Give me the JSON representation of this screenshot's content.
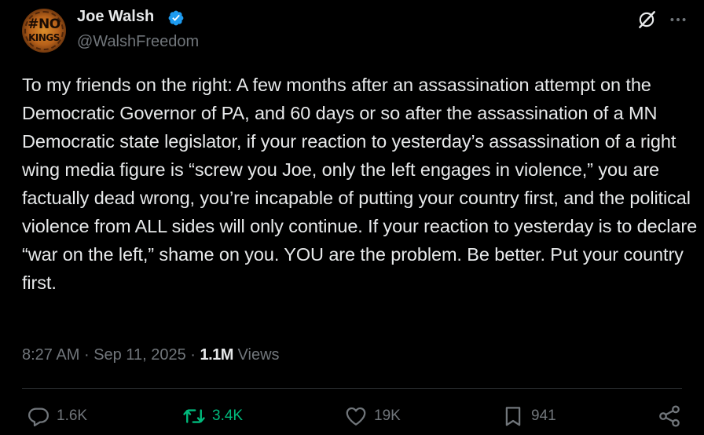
{
  "author": {
    "avatar_line1": "#NO",
    "avatar_line2": "KINGS",
    "name": "Joe Walsh",
    "handle": "@WalshFreedom",
    "verified": true
  },
  "post": {
    "text": "To my friends on the right: A few months after an assassination attempt on the Democratic Governor of PA, and 60 days or so after the assassination of a MN Democratic state legislator, if your reaction to yesterday’s assassination of a right wing media figure is “screw you Joe, only the left engages in violence,” you are factually dead wrong, you’re incapable of putting your country first, and the political violence from ALL sides will only continue. If your reaction to yesterday is to declare “war on the left,” shame on you. YOU are the problem. Be better. Put your country first.",
    "time": "8:27 AM",
    "separator": "·",
    "date": "Sep 11, 2025",
    "views_count": "1.1M",
    "views_label": "Views"
  },
  "actions": {
    "replies": "1.6K",
    "reposts": "3.4K",
    "likes": "19K",
    "bookmarks": "941"
  },
  "icons": {
    "verified": "verified-badge-icon",
    "grok": "grok-icon",
    "more": "more-icon",
    "reply": "reply-icon",
    "repost": "repost-icon",
    "like": "heart-icon",
    "bookmark": "bookmark-icon",
    "share": "share-icon"
  },
  "colors": {
    "background": "#000000",
    "text": "#e7e9ea",
    "secondary": "#71767b",
    "verified": "#1d9bf0",
    "repost_active": "#00ba7c",
    "divider": "#2f3336"
  }
}
